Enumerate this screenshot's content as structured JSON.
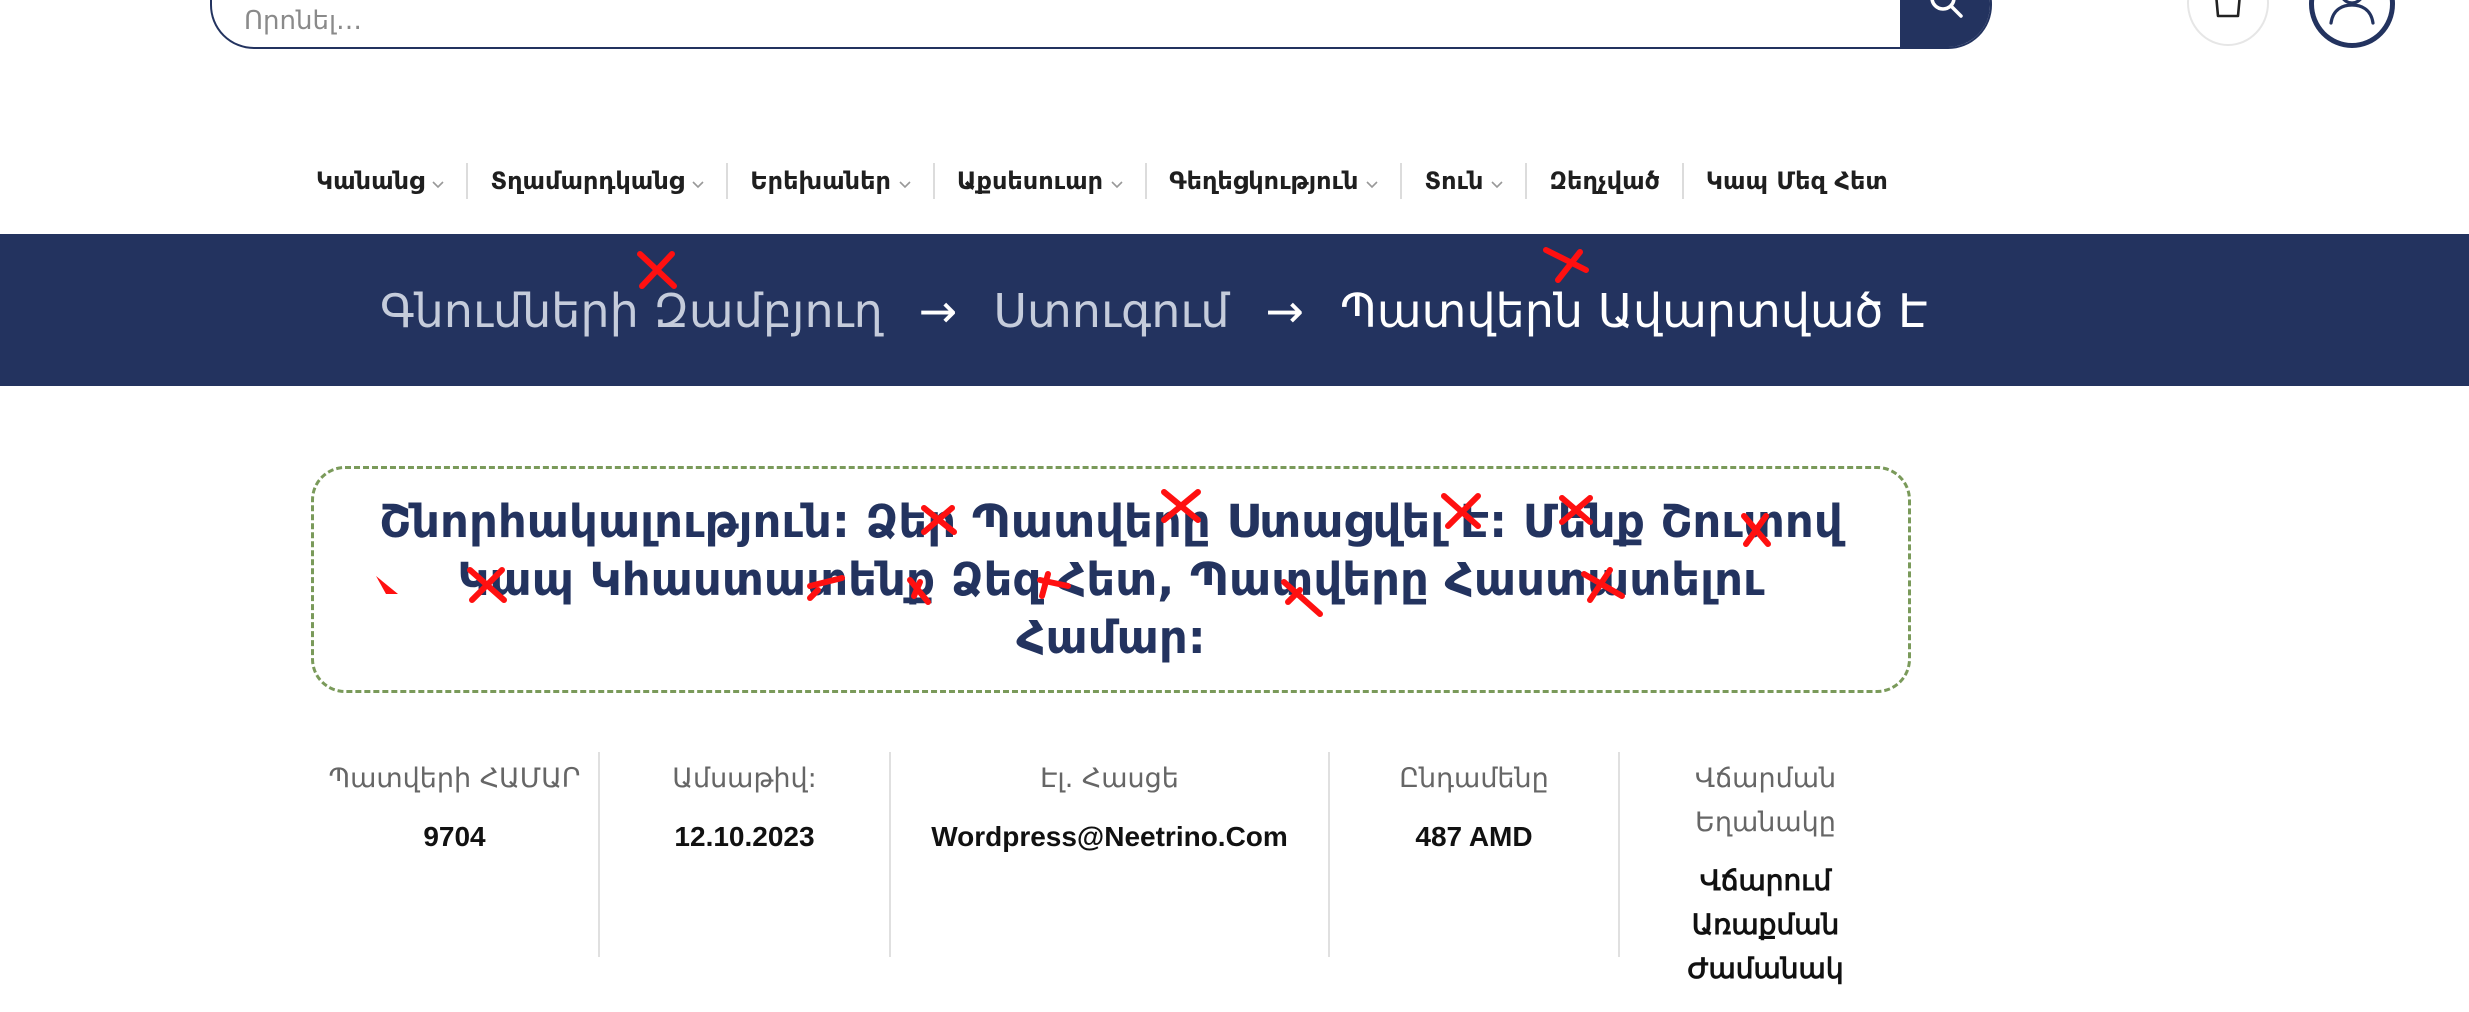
{
  "header": {
    "search_placeholder": "Որոնել…",
    "icons": {
      "search": "search-icon",
      "cart": "shopping-bag-icon",
      "user": "user-icon"
    }
  },
  "nav": {
    "items": [
      {
        "label": "Կանանց",
        "has_dropdown": true
      },
      {
        "label": "Տղամարդկանց",
        "has_dropdown": true
      },
      {
        "label": "Երեխաներ",
        "has_dropdown": true
      },
      {
        "label": "Աքսեսուար",
        "has_dropdown": true
      },
      {
        "label": "Գեղեցկություն",
        "has_dropdown": true
      },
      {
        "label": "Տուն",
        "has_dropdown": true
      },
      {
        "label": "Զեղչված",
        "has_dropdown": false
      },
      {
        "label": "Կապ Մեզ Հետ",
        "has_dropdown": false
      }
    ]
  },
  "breadcrumb": {
    "step1": "Գնումների Զամբյուղ",
    "step2": "Ստուգում",
    "current": "Պատվերն Ավարտված Է",
    "separator": "→"
  },
  "notice": {
    "text": "Շնորհակալություն: Ձեր Պատվերը Ստացվել Է: Մենք Շուտով Կապ Կհաստատենք Ձեզ Հետ, Պատվերը Հաստատելու Համար:"
  },
  "order": {
    "number_label": "Պատվերի ՀԱՄԱՐ",
    "number": "9704",
    "date_label": "Ամսաթիվ:",
    "date": "12.10.2023",
    "email_label": "Էլ. Հասցե",
    "email": "Wordpress@Neetrino.Com",
    "total_label": "Ընդամենը",
    "total": "487 AMD",
    "payment_label": "Վճարման Եղանակը",
    "payment": "Վճարում Առաքման Ժամանակ"
  },
  "colors": {
    "brand_navy": "#23335f",
    "notice_border": "#7a9a5a",
    "annotation_red": "#ff0000"
  }
}
